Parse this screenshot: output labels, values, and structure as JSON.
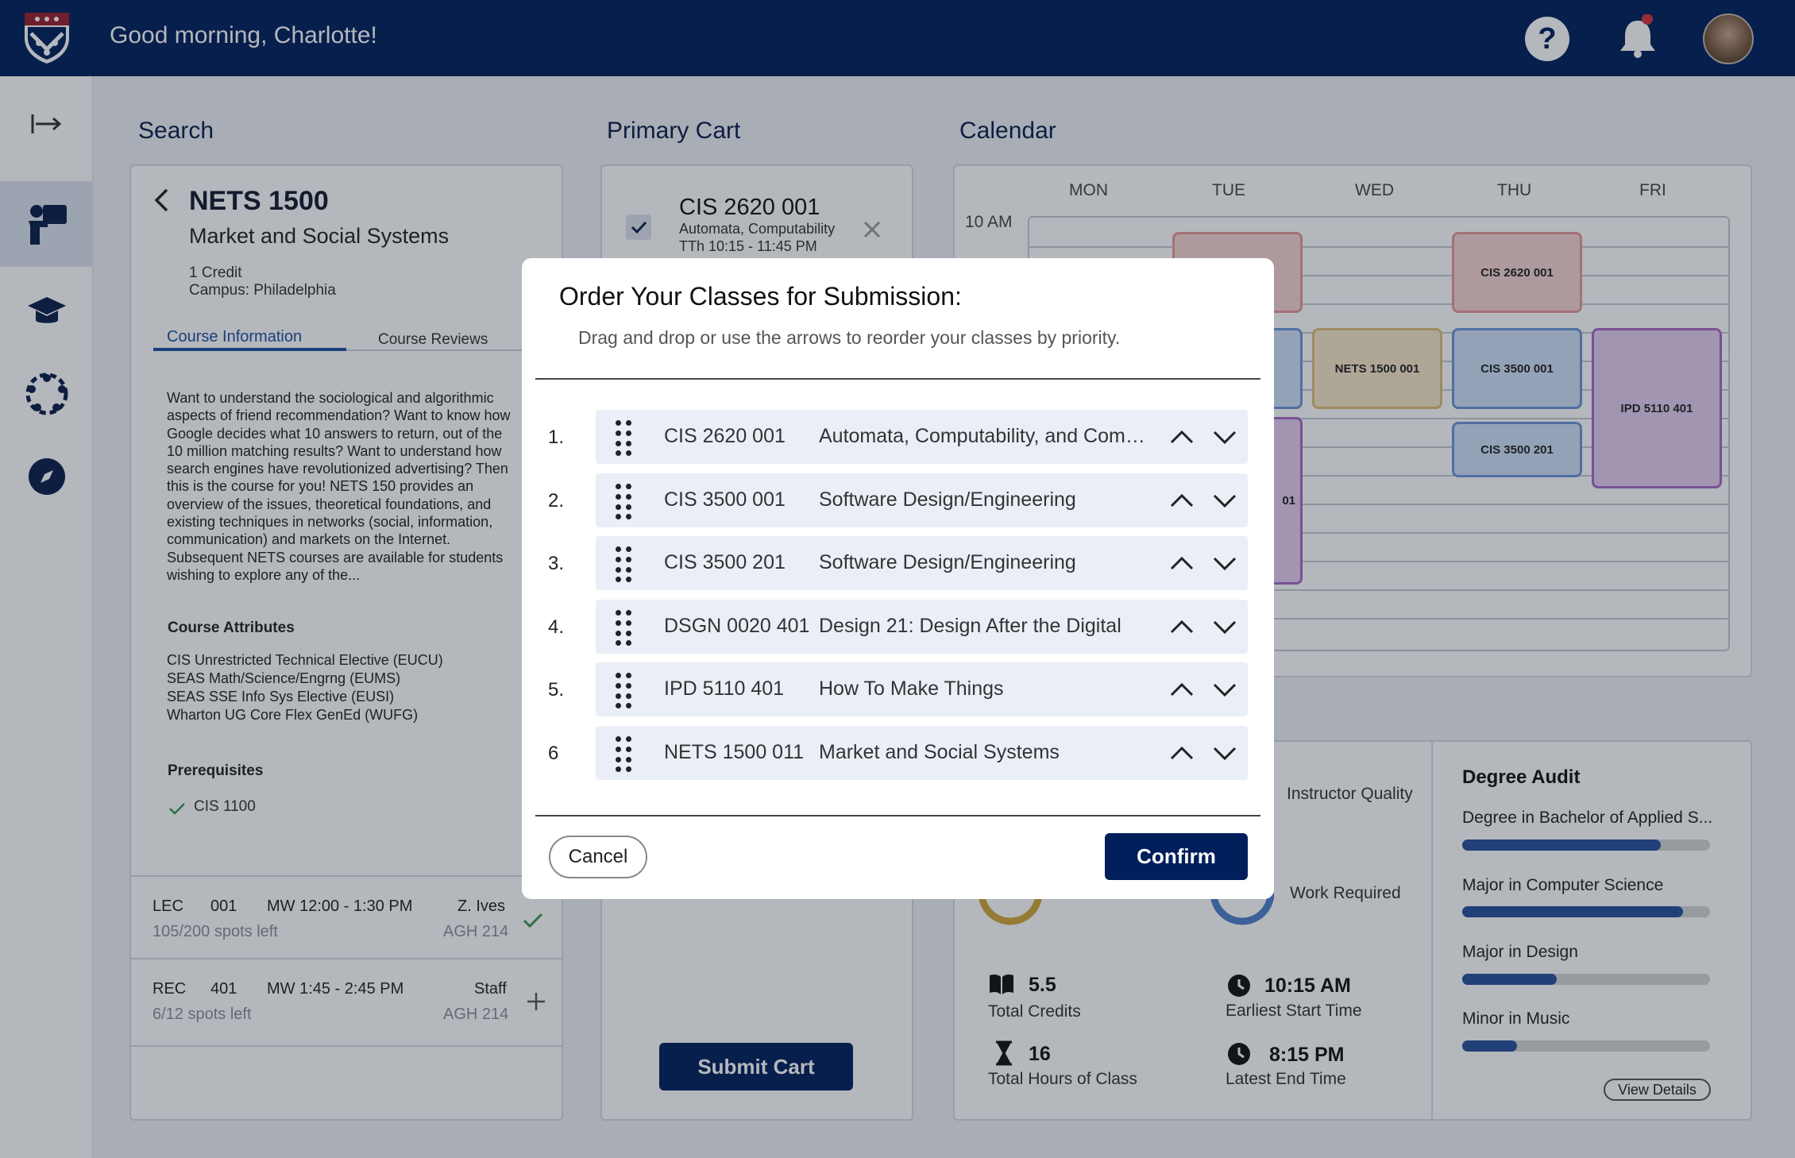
{
  "header": {
    "greeting": "Good morning, Charlotte!"
  },
  "sidebar": {
    "items": [
      "expand",
      "course-search",
      "degree",
      "community",
      "explore"
    ]
  },
  "search": {
    "section_title": "Search",
    "course_code": "NETS 1500",
    "course_name": "Market and Social Systems",
    "credits": "1 Credit",
    "campus": "Campus: Philadelphia",
    "tabs": [
      "Course Information",
      "Course Reviews"
    ],
    "description": "Want to understand the sociological and algorithmic aspects of friend recommendation? Want to know how Google decides what 10 answers to return, out of the 10 million matching results? Want to understand how search engines have revolutionized advertising? Then this is the course for you! NETS 150 provides an overview of the issues, theoretical foundations, and existing techniques in networks (social, information, communication) and markets on the Internet. Subsequent NETS courses are available for students wishing to explore any of the...",
    "attributes_title": "Course Attributes",
    "attributes": [
      "CIS Unrestricted Technical Elective (EUCU)",
      "SEAS Math/Science/Engrng (EUMS)",
      "SEAS SSE Info Sys Elective (EUSI)",
      "Wharton UG Core Flex GenEd (WUFG)"
    ],
    "prereq_title": "Prerequisites",
    "prereq": "CIS 1100",
    "sections": [
      {
        "type": "LEC",
        "num": "001",
        "time": "MW 12:00 - 1:30 PM",
        "instructor": "Z. Ives",
        "spots": "105/200 spots left",
        "room": "AGH 214"
      },
      {
        "type": "REC",
        "num": "401",
        "time": "MW 1:45 - 2:45 PM",
        "instructor": "Staff",
        "spots": "6/12 spots left",
        "room": "AGH 214"
      }
    ]
  },
  "cart": {
    "section_title": "Primary Cart",
    "item": {
      "code": "CIS 2620 001",
      "name": "Automata, Computability",
      "time": "TTh 10:15 - 11:45 PM"
    },
    "submit_label": "Submit Cart"
  },
  "calendar": {
    "section_title": "Calendar",
    "days": [
      "MON",
      "TUE",
      "WED",
      "THU",
      "FRI"
    ],
    "time_label": "10 AM",
    "events": [
      {
        "label": "CIS 2620 001"
      },
      {
        "label": "NETS 1500 001"
      },
      {
        "label": "CIS 3500 001"
      },
      {
        "label": "CIS 3500 201"
      },
      {
        "label": "IPD 5110 401"
      },
      {
        "label": "01"
      }
    ]
  },
  "stats": {
    "instructor_quality": "Instructor Quality",
    "work_required": "Work Required",
    "total_credits_value": "5.5",
    "total_credits_label": "Total Credits",
    "hours_value": "16",
    "hours_label": "Total Hours of Class",
    "earliest_value": "10:15 AM",
    "earliest_label": "Earliest Start Time",
    "latest_value": "8:15 PM",
    "latest_label": "Latest End Time"
  },
  "audit": {
    "title": "Degree Audit",
    "items": [
      {
        "label": "Degree in Bachelor of Applied S...",
        "progress": 0.8
      },
      {
        "label": "Major in Computer Science",
        "progress": 0.89
      },
      {
        "label": "Major in Design",
        "progress": 0.38
      },
      {
        "label": "Minor in Music",
        "progress": 0.22
      }
    ],
    "view_details": "View Details"
  },
  "modal": {
    "title": "Order Your Classes for Submission:",
    "subtitle": "Drag and drop or use the arrows to reorder your classes by priority.",
    "classes": [
      {
        "num": "1.",
        "code": "CIS 2620 001",
        "title": "Automata, Computability, and Compl..."
      },
      {
        "num": "2.",
        "code": "CIS 3500 001",
        "title": "Software Design/Engineering"
      },
      {
        "num": "3.",
        "code": "CIS 3500 201",
        "title": "Software Design/Engineering"
      },
      {
        "num": "4.",
        "code": "DSGN 0020 401",
        "title": "Design 21: Design After the Digital"
      },
      {
        "num": "5.",
        "code": "IPD 5110 401",
        "title": "How To Make Things"
      },
      {
        "num": "6",
        "code": "NETS 1500 011",
        "title": "Market and Social Systems"
      }
    ],
    "cancel_label": "Cancel",
    "confirm_label": "Confirm"
  },
  "colors": {
    "brand_navy": "#011f5b",
    "progress_blue": "#27509b"
  }
}
